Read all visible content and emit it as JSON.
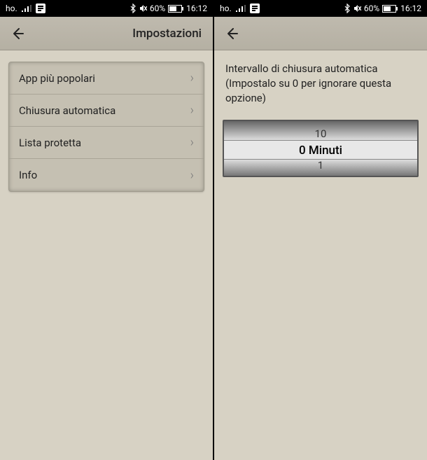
{
  "status": {
    "carrier": "ho.",
    "bt": "bluetooth",
    "alarm": "alarm",
    "battery": "60%",
    "time": "16:12"
  },
  "left": {
    "title": "Impostazioni",
    "menu": [
      "App più popolari",
      "Chiusura automatica",
      "Lista protetta",
      "Info"
    ]
  },
  "right": {
    "description": "Intervallo di chiusura automatica (Impostalo su 0 per ignorare questa opzione)",
    "picker": {
      "prev": "10",
      "selected": "0 Minuti",
      "next": "1"
    }
  }
}
